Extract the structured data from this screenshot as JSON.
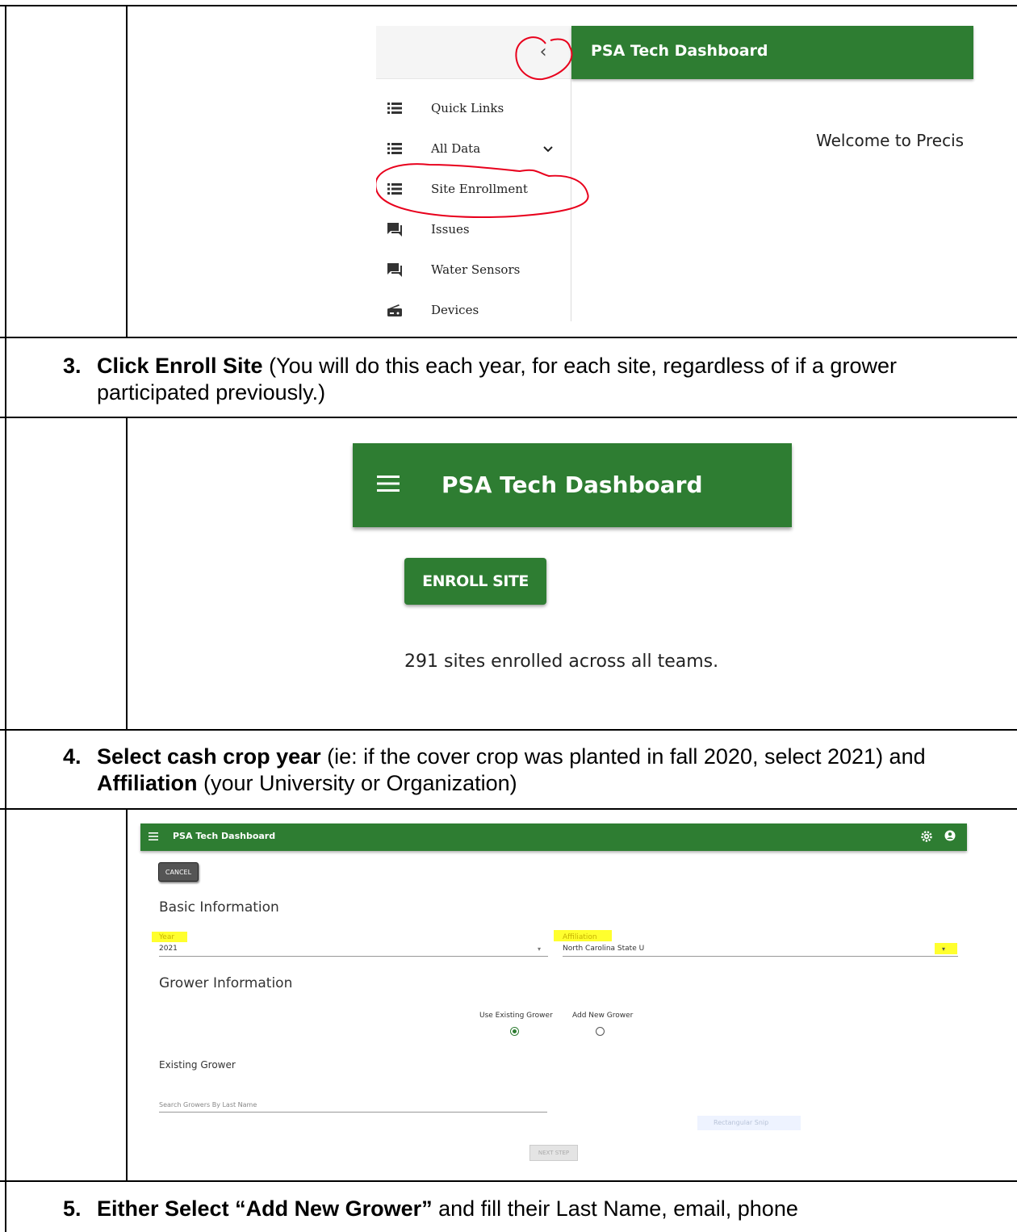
{
  "screenshot1": {
    "title": "PSA Tech Dashboard",
    "collapse_glyph": "‹",
    "welcome_text": "Welcome to Precis",
    "nav": [
      {
        "label": "Quick Links",
        "icon": "list-icon"
      },
      {
        "label": "All Data",
        "icon": "list-icon",
        "expand": "⌄"
      },
      {
        "label": "Site Enrollment",
        "icon": "list-icon"
      },
      {
        "label": "Issues",
        "icon": "forum-icon"
      },
      {
        "label": "Water Sensors",
        "icon": "forum-icon"
      },
      {
        "label": "Devices",
        "icon": "router-icon"
      }
    ],
    "annotation_color": "#e8001c"
  },
  "step3": {
    "number": "3.",
    "bold": "Click Enroll Site",
    "text": " (You will do this each year, for each site, regardless of if a grower participated previously.)"
  },
  "screenshot2": {
    "title": "PSA Tech Dashboard",
    "button": "ENROLL SITE",
    "count_text": "291 sites enrolled across all teams."
  },
  "step4": {
    "number": "4.",
    "bold1": "Select cash crop year",
    "text1": " (ie: if the cover crop was planted in fall 2020, select 2021) and ",
    "bold2": "Affiliation",
    "text2": " (your University or Organization)"
  },
  "screenshot3": {
    "title": "PSA Tech Dashboard",
    "cancel": "CANCEL",
    "basic_heading": "Basic Information",
    "year_label": "Year",
    "year_value": "2021",
    "affiliation_label": "Affiliation",
    "affiliation_value": "North Carolina State U",
    "grower_heading": "Grower Information",
    "radio_existing": "Use Existing Grower",
    "radio_new": "Add New Grower",
    "existing_heading": "Existing Grower",
    "search_placeholder": "Search Growers By Last Name",
    "snip_text": "Rectangular Snip",
    "next": "NEXT STEP",
    "highlight_color": "#ffff2e"
  },
  "step5": {
    "number": "5.",
    "text_pre": "Either Select ",
    "bold": "“Add New Grower”",
    "text_post": " and fill their Last Name, email, phone"
  },
  "colors": {
    "brand_green": "#2e7d32"
  }
}
